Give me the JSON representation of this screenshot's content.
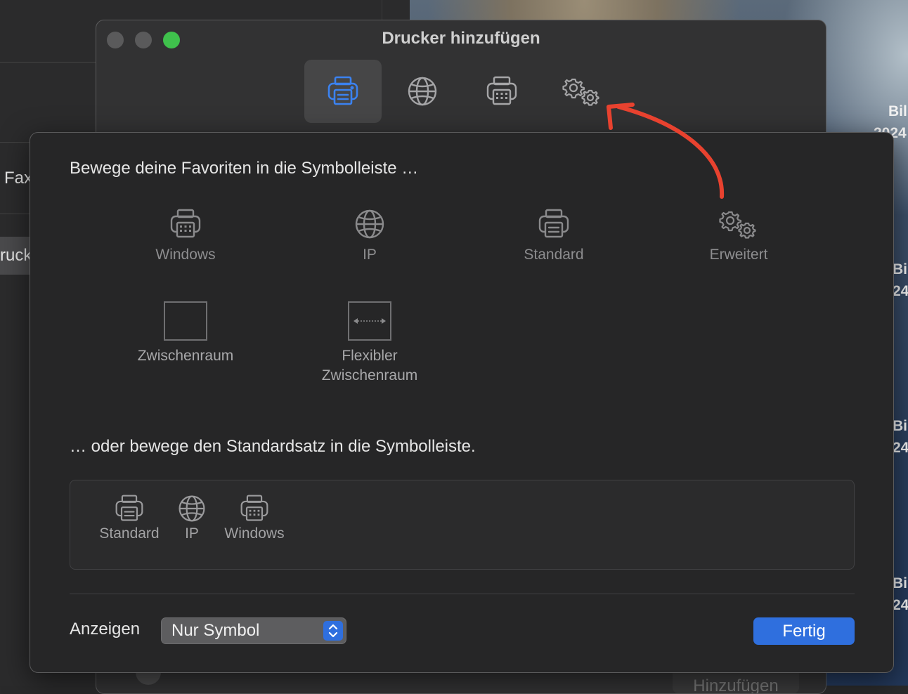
{
  "background": {
    "left_texts": [
      "Fax",
      "ruck"
    ],
    "desktop_labels": [
      "Bil",
      "2024",
      "Bil",
      "24",
      "Bil",
      "24",
      "Bil",
      "24"
    ]
  },
  "window": {
    "title": "Drucker hinzufügen",
    "toolbar": [
      {
        "icon": "printer-icon",
        "active": true
      },
      {
        "icon": "globe-icon",
        "active": false
      },
      {
        "icon": "windows-printer-icon",
        "active": false
      },
      {
        "icon": "gears-icon",
        "active": false
      }
    ],
    "bottom_button": "Hinzufügen"
  },
  "sheet": {
    "favorites_heading": "Bewege deine Favoriten in die Symbolleiste …",
    "favorites": [
      {
        "label": "Windows",
        "icon": "windows-printer-icon"
      },
      {
        "label": "IP",
        "icon": "globe-icon"
      },
      {
        "label": "Standard",
        "icon": "printer-icon"
      },
      {
        "label": "Erweitert",
        "icon": "gears-icon"
      }
    ],
    "spacers": [
      {
        "label": "Zwischenraum",
        "icon": "space-icon"
      },
      {
        "label": "Flexibler Zwischenraum",
        "icon": "flexible-space-icon"
      }
    ],
    "default_heading": "… oder bewege den Standardsatz in die Symbolleiste.",
    "default_set": [
      {
        "label": "Standard",
        "icon": "printer-icon"
      },
      {
        "label": "IP",
        "icon": "globe-icon"
      },
      {
        "label": "Windows",
        "icon": "windows-printer-icon"
      }
    ],
    "show_label": "Anzeigen",
    "show_value": "Nur Symbol",
    "done_label": "Fertig"
  },
  "colors": {
    "accent": "#2f6fde",
    "annotation_arrow": "#e8422f",
    "zoom_button": "#3fc14c"
  }
}
